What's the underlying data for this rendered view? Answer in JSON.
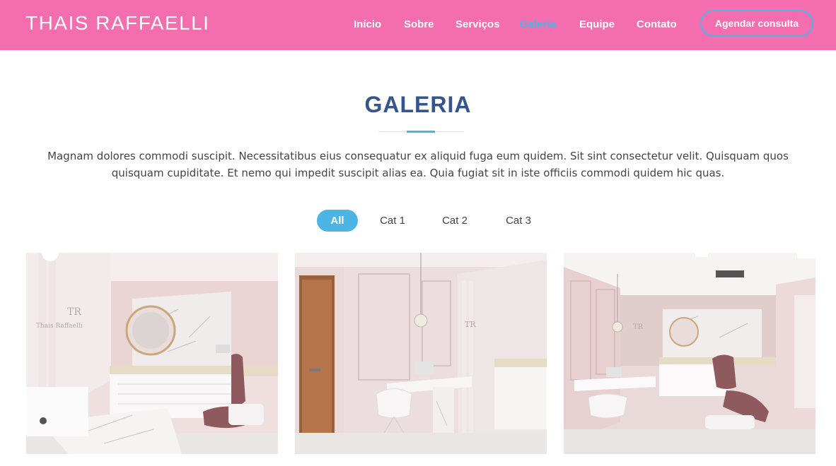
{
  "header": {
    "brand": "THAIS RAFFAELLI",
    "nav": [
      "Início",
      "Sobre",
      "Serviços",
      "Galeria",
      "Equipe",
      "Contato"
    ],
    "active_nav": "Galeria",
    "cta_label": "Agendar consulta"
  },
  "section": {
    "title": "GALERIA",
    "description": "Magnam dolores commodi suscipit. Necessitatibus eius consequatur ex aliquid fuga eum quidem. Sit sint consectetur velit. Quisquam quos quisquam cupiditate. Et nemo qui impedit suscipit alias ea. Quia fugiat sit in iste officiis commodi quidem hic quas."
  },
  "filters": [
    "All",
    "Cat 1",
    "Cat 2",
    "Cat 3"
  ],
  "gallery": {
    "logo_mark": "TR",
    "logo_name": "Thais Raffaelli"
  },
  "colors": {
    "header_bg": "#f46daf",
    "accent_blue": "#4db4e6",
    "title_navy": "#35558c"
  }
}
